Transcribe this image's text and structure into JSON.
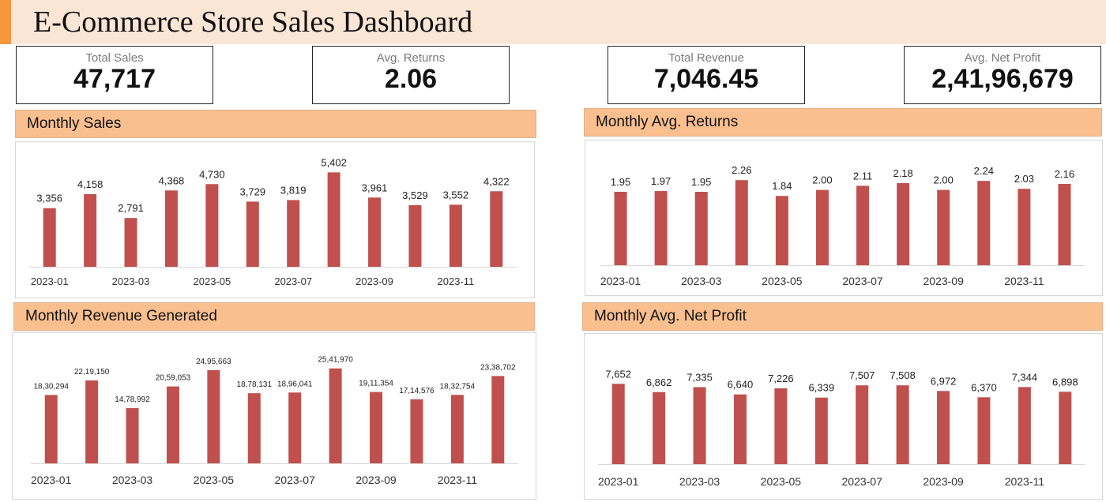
{
  "dashboard": {
    "title": "E-Commerce Store Sales Dashboard"
  },
  "kpis": [
    {
      "label": "Total Sales",
      "value": "47,717"
    },
    {
      "label": "Avg. Returns",
      "value": "2.06"
    },
    {
      "label": "Total Revenue",
      "value": "7,046.45"
    },
    {
      "label": "Avg. Net Profit",
      "value": "2,41,96,679"
    }
  ],
  "colors": {
    "bar": "#c0504d",
    "header_bg": "#f9bf8f",
    "title_bg": "#fbe6d6",
    "accent": "#f7963c"
  },
  "chart_data": [
    {
      "title": "Monthly Sales",
      "type": "bar",
      "categories": [
        "2023-01",
        "2023-02",
        "2023-03",
        "2023-04",
        "2023-05",
        "2023-06",
        "2023-07",
        "2023-08",
        "2023-09",
        "2023-10",
        "2023-11",
        "2023-12"
      ],
      "tick_labels": [
        "2023-01",
        "2023-03",
        "2023-05",
        "2023-07",
        "2023-09",
        "2023-11"
      ],
      "values": [
        3356,
        4158,
        2791,
        4368,
        4730,
        3729,
        3819,
        5402,
        3961,
        3529,
        3552,
        4322
      ],
      "labels": [
        "3,356",
        "4,158",
        "2,791",
        "4,368",
        "4,730",
        "3,729",
        "3,819",
        "5,402",
        "3,961",
        "3,529",
        "3,552",
        "4,322"
      ],
      "ylim": [
        0,
        5600
      ]
    },
    {
      "title": "Monthly Avg. Returns",
      "type": "bar",
      "categories": [
        "2023-01",
        "2023-02",
        "2023-03",
        "2023-04",
        "2023-05",
        "2023-06",
        "2023-07",
        "2023-08",
        "2023-09",
        "2023-10",
        "2023-11",
        "2023-12"
      ],
      "tick_labels": [
        "2023-01",
        "2023-03",
        "2023-05",
        "2023-07",
        "2023-09",
        "2023-11"
      ],
      "values": [
        1.95,
        1.97,
        1.95,
        2.26,
        1.84,
        2.0,
        2.11,
        2.18,
        2.0,
        2.24,
        2.03,
        2.16
      ],
      "labels": [
        "1.95",
        "1.97",
        "1.95",
        "2.26",
        "1.84",
        "2.00",
        "2.11",
        "2.18",
        "2.00",
        "2.24",
        "2.03",
        "2.16"
      ],
      "ylim": [
        0,
        2.6
      ]
    },
    {
      "title": "Monthly Revenue Generated",
      "type": "bar",
      "categories": [
        "2023-01",
        "2023-02",
        "2023-03",
        "2023-04",
        "2023-05",
        "2023-06",
        "2023-07",
        "2023-08",
        "2023-09",
        "2023-10",
        "2023-11",
        "2023-12"
      ],
      "tick_labels": [
        "2023-01",
        "2023-03",
        "2023-05",
        "2023-07",
        "2023-09",
        "2023-11"
      ],
      "values": [
        1830294,
        2219150,
        1478992,
        2059053,
        2495663,
        1878131,
        1896041,
        2541970,
        1911354,
        1714576,
        1832754,
        2338702
      ],
      "labels": [
        "18,30,294",
        "22,19,150",
        "14,78,992",
        "20,59,053",
        "24,95,663",
        "18,78,131",
        "18,96,041",
        "25,41,970",
        "19,11,354",
        "17,14,576",
        "18,32,754",
        "23,38,702"
      ],
      "ylim": [
        0,
        2600000
      ]
    },
    {
      "title": "Monthly Avg. Net Profit",
      "type": "bar",
      "categories": [
        "2023-01",
        "2023-02",
        "2023-03",
        "2023-04",
        "2023-05",
        "2023-06",
        "2023-07",
        "2023-08",
        "2023-09",
        "2023-10",
        "2023-11",
        "2023-12"
      ],
      "tick_labels": [
        "2023-01",
        "2023-03",
        "2023-05",
        "2023-07",
        "2023-09",
        "2023-11"
      ],
      "values": [
        7652,
        6862,
        7335,
        6640,
        7226,
        6339,
        7507,
        7508,
        6972,
        6370,
        7344,
        6898
      ],
      "labels": [
        "7,652",
        "6,862",
        "7,335",
        "6,640",
        "7,226",
        "6,339",
        "7,507",
        "7,508",
        "6,972",
        "6,370",
        "7,344",
        "6,898"
      ],
      "ylim": [
        0,
        8800
      ]
    }
  ]
}
